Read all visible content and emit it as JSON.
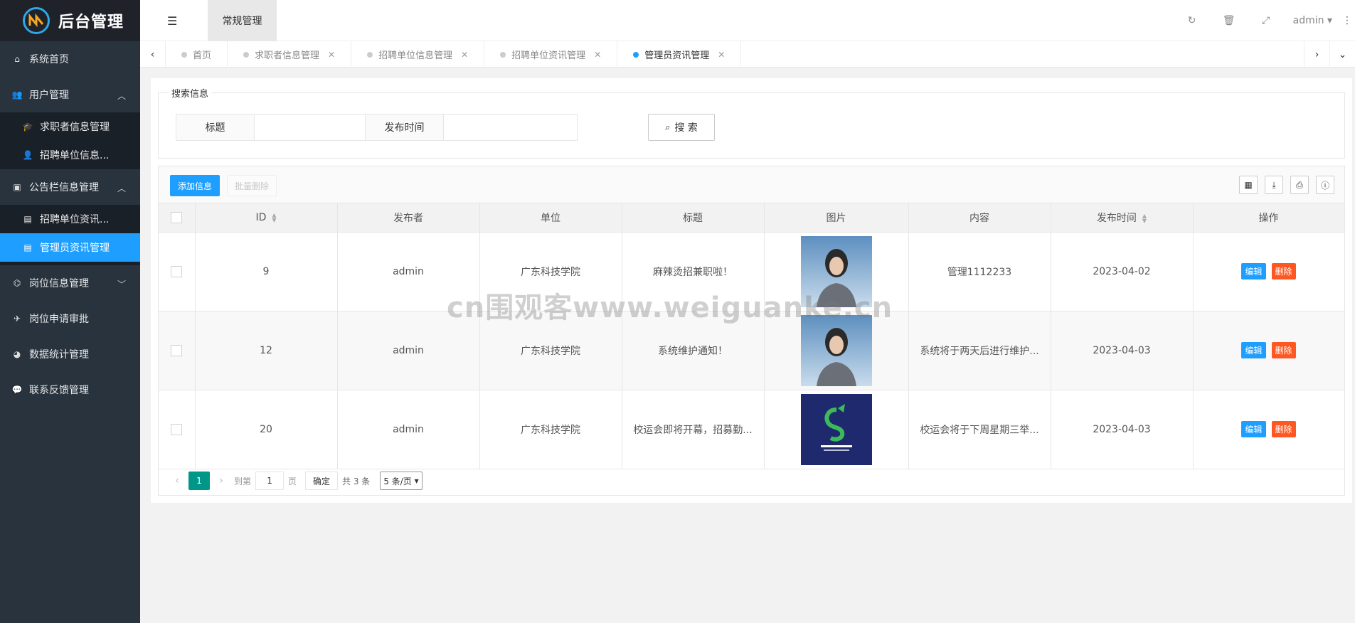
{
  "sidebar": {
    "app_title": "后台管理",
    "items": {
      "home": "系统首页",
      "user_mgmt": "用户管理",
      "seeker_info": "求职者信息管理",
      "employer_info": "招聘单位信息...",
      "bulletin_mgmt": "公告栏信息管理",
      "employer_news": "招聘单位资讯...",
      "admin_news": "管理员资讯管理",
      "job_info": "岗位信息管理",
      "job_apply": "岗位申请审批",
      "stats": "数据统计管理",
      "feedback": "联系反馈管理"
    }
  },
  "header": {
    "tab_label": "常规管理",
    "user": "admin"
  },
  "tabs": [
    {
      "label": "首页",
      "active": false,
      "closable": false
    },
    {
      "label": "求职者信息管理",
      "active": false,
      "closable": true
    },
    {
      "label": "招聘单位信息管理",
      "active": false,
      "closable": true
    },
    {
      "label": "招聘单位资讯管理",
      "active": false,
      "closable": true
    },
    {
      "label": "管理员资讯管理",
      "active": true,
      "closable": true
    }
  ],
  "search": {
    "legend": "搜索信息",
    "title_label": "标题",
    "title_value": "",
    "date_label": "发布时间",
    "date_value": "",
    "button": "搜 索"
  },
  "toolbar": {
    "add": "添加信息",
    "batch_delete": "批量删除"
  },
  "table": {
    "columns": [
      "ID",
      "发布者",
      "单位",
      "标题",
      "图片",
      "内容",
      "发布时间",
      "操作"
    ],
    "rows": [
      {
        "id": "9",
        "publisher": "admin",
        "unit": "广东科技学院",
        "title": "麻辣烫招兼职啦！",
        "image": "woman-photo",
        "content": "管理1112233",
        "date": "2023-04-02"
      },
      {
        "id": "12",
        "publisher": "admin",
        "unit": "广东科技学院",
        "title": "系统维护通知！",
        "image": "woman-photo",
        "content": "系统将于两天后进行维护...",
        "date": "2023-04-03"
      },
      {
        "id": "20",
        "publisher": "admin",
        "unit": "广东科技学院",
        "title": "校运会即将开幕，招募勤...",
        "image": "logo-image",
        "content": "校运会将于下周星期三举...",
        "date": "2023-04-03"
      }
    ],
    "edit_label": "编辑",
    "delete_label": "删除"
  },
  "pager": {
    "current": "1",
    "goto_prefix": "到第",
    "goto_value": "1",
    "goto_suffix": "页",
    "confirm": "确定",
    "total": "共 3 条",
    "page_size": "5 条/页"
  },
  "watermark": "cn围观客www.weiguanke.cn",
  "colors": {
    "sidebar_bg": "#28333e",
    "accent": "#1e9fff",
    "danger": "#ff5722",
    "pager_active": "#009688"
  }
}
